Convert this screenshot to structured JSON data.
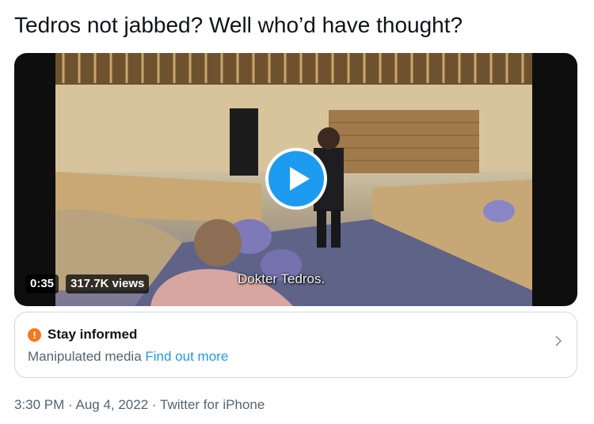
{
  "tweet": {
    "text": "Tedros not jabbed? Well who’d have thought?"
  },
  "video": {
    "duration": "0:35",
    "views": "317.7K views",
    "caption": "Dokter Tedros.",
    "play_icon": "play-icon"
  },
  "notice": {
    "icon": "alert-icon",
    "icon_glyph": "!",
    "title": "Stay informed",
    "label": "Manipulated media",
    "link": "Find out more",
    "chevron_icon": "chevron-right-icon"
  },
  "meta": {
    "time": "3:30 PM",
    "sep1": " · ",
    "date": "Aug 4, 2022",
    "sep2": " · ",
    "source": "Twitter for iPhone"
  },
  "colors": {
    "accent": "#1d9bf0",
    "secondary_text": "#536471",
    "warning": "#f4781e"
  }
}
